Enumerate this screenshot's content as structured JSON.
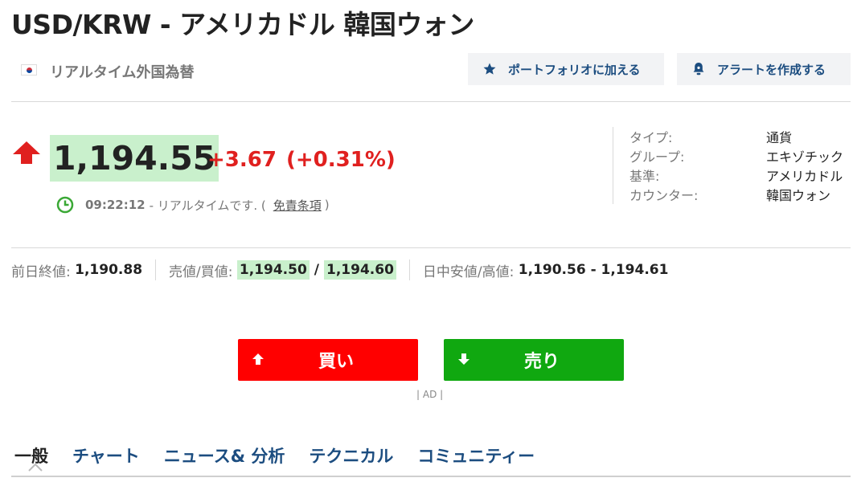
{
  "title": "USD/KRW - アメリカドル 韓国ウォン",
  "subheader": {
    "realtime_label": "リアルタイム外国為替",
    "portfolio_button": "ポートフォリオに加える",
    "alert_button": "アラートを作成する"
  },
  "quote": {
    "price": "1,194.55",
    "change": "+3.67",
    "change_pct": "(+0.31%)",
    "time": "09:22:12",
    "time_suffix": "- リアルタイムです. (",
    "disclaimer_link": "免責条項",
    "time_close": ")"
  },
  "info": {
    "rows": [
      {
        "key": "タイプ:",
        "value": "通貨"
      },
      {
        "key": "グループ:",
        "value": "エキゾチック"
      },
      {
        "key": "基準:",
        "value": "アメリカドル"
      },
      {
        "key": "カウンター:",
        "value": "韓国ウォン"
      }
    ]
  },
  "stats": {
    "prev_close_label": "前日終値:",
    "prev_close": "1,190.88",
    "bid_ask_label": "売値/買値:",
    "bid": "1,194.50",
    "slash": "/",
    "ask": "1,194.60",
    "range_label": "日中安値/高値:",
    "range": "1,190.56 - 1,194.61"
  },
  "trade": {
    "buy": "買い",
    "sell": "売り",
    "ad": "| AD |"
  },
  "tabs": [
    "一般",
    "チャート",
    "ニュース& 分析",
    "テクニカル",
    "コミュニティー"
  ],
  "colors": {
    "up": "#e0201f",
    "buy": "#ff0000",
    "sell": "#10a810",
    "highlight": "#c9f0cc",
    "link": "#1c4d80"
  }
}
